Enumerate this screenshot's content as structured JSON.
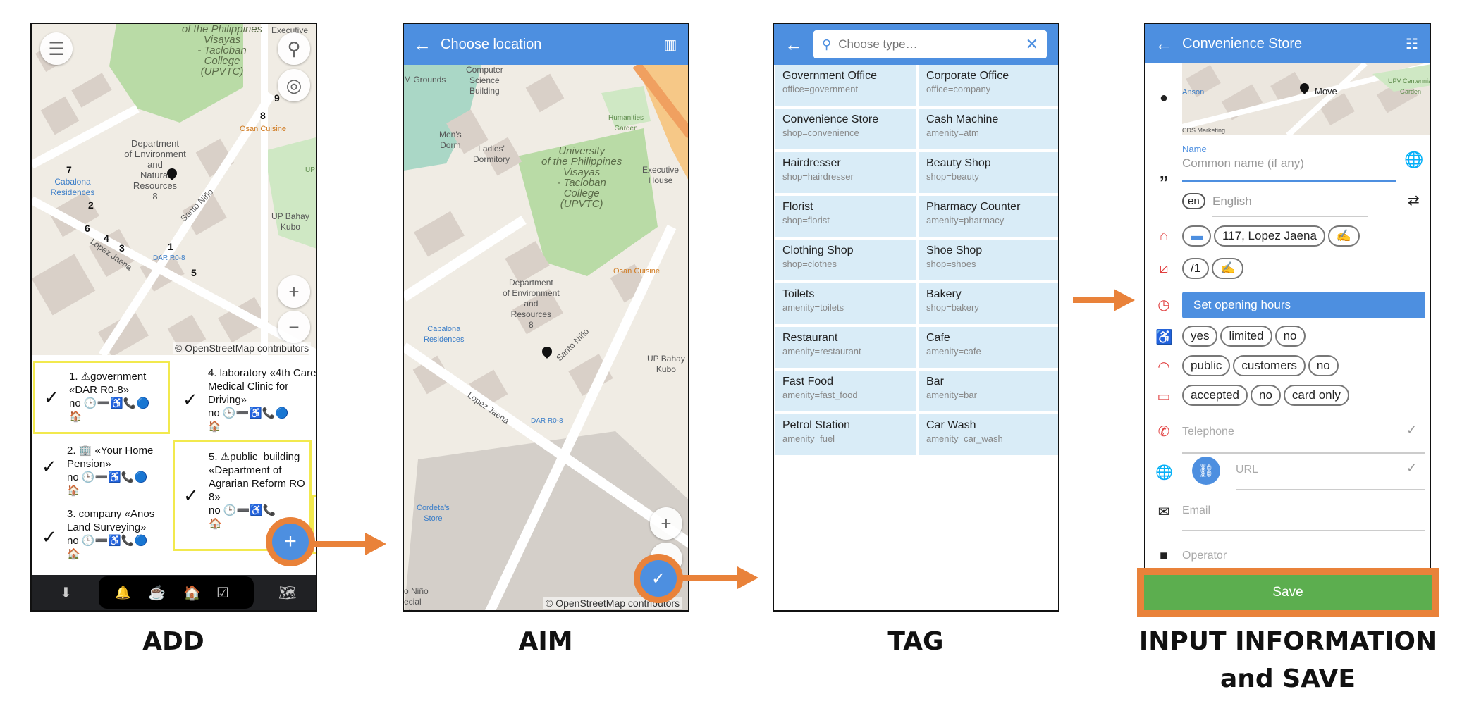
{
  "steps": {
    "add": "ADD",
    "aim": "AIM",
    "tag": "TAG",
    "input_line1": "INPUT INFORMATION",
    "input_line2": "and SAVE"
  },
  "colors": {
    "accent": "#4d8fe0",
    "highlight": "#e9823a",
    "save_green": "#5cae4f",
    "tag_bg": "#d9ecf7",
    "quest_highlight": "#f2e94e"
  },
  "screen1": {
    "map_labels": {
      "uni": "of the Philippines\nVisayas\n- Tacloban\nCollege\n(UPVTC)",
      "dept": "Department\nof Environment\nand\nNatural\nResources\n8",
      "cabalona": "Cabalona\nResidences",
      "santo_nino": "Santo Niño",
      "lopez_jaena": "Lopez Jaena",
      "dar": "DAR R0-8",
      "osan": "Osan Cuisine",
      "upbahay": "UP Bahay\nKubo",
      "executive": "Executive",
      "up": "UP"
    },
    "pins": [
      "7",
      "2",
      "6",
      "4",
      "3",
      "1",
      "5",
      "9",
      "8"
    ],
    "credit": "© OpenStreetMap contributors",
    "quests": [
      {
        "text": "1. ⚠government «DAR R0-8»",
        "icons": "no 🕒➖♿📞🔵",
        "extra": "🏠"
      },
      {
        "text": "4. laboratory «4th Care Medical Clinic for Driving»",
        "icons": "no 🕒➖♿📞🔵",
        "extra": "🏠"
      },
      {
        "text": "2. 🏢 «Your Home Pension»",
        "icons": "no 🕒➖♿📞🔵",
        "extra": "🏠"
      },
      {
        "text": "5. ⚠public_building «Department of Agrarian Reform RO 8»",
        "icons": "no 🕒➖♿📞",
        "extra": "🏠"
      },
      {
        "text": "3. company «Anos Land Surveying»",
        "icons": "no 🕒➖♿📞🔵",
        "extra": "🏠"
      }
    ],
    "nav": [
      "⬇",
      "🔔",
      "☕",
      "🏠",
      "☑",
      "🗺"
    ]
  },
  "screen2": {
    "title": "Choose location",
    "map_labels": {
      "grounds": "M Grounds",
      "computer": "Computer\nScience\nBuilding",
      "mens": "Men's\nDorm",
      "ladies": "Ladies'\nDormitory",
      "uni": "University\nof the Philippines\nVisayas\n- Tacloban\nCollege\n(UPVTC)",
      "humanities": "Humanities\nGarden",
      "executive": "Executive\nHouse",
      "osan": "Osan Cuisine",
      "dept": "Department\nof Environment\nand\nResources\n8",
      "cabalona": "Cabalona\nResidences",
      "santo_nino": "Santo Niño",
      "upbahay": "UP Bahay\nKubo",
      "lopez": "Lopez Jaena",
      "dar": "DAR R0-8",
      "cordeta": "Cordeta's\nStore",
      "snino": "o Niño\necial\nation"
    },
    "credit": "© OpenStreetMap contributors"
  },
  "screen3": {
    "search_placeholder": "Choose type…",
    "types": [
      {
        "name": "Government Office",
        "tag": "office=government"
      },
      {
        "name": "Corporate Office",
        "tag": "office=company"
      },
      {
        "name": "Convenience Store",
        "tag": "shop=convenience"
      },
      {
        "name": "Cash Machine",
        "tag": "amenity=atm"
      },
      {
        "name": "Hairdresser",
        "tag": "shop=hairdresser"
      },
      {
        "name": "Beauty Shop",
        "tag": "shop=beauty"
      },
      {
        "name": "Florist",
        "tag": "shop=florist"
      },
      {
        "name": "Pharmacy Counter",
        "tag": "amenity=pharmacy"
      },
      {
        "name": "Clothing Shop",
        "tag": "shop=clothes"
      },
      {
        "name": "Shoe Shop",
        "tag": "shop=shoes"
      },
      {
        "name": "Toilets",
        "tag": "amenity=toilets"
      },
      {
        "name": "Bakery",
        "tag": "shop=bakery"
      },
      {
        "name": "Restaurant",
        "tag": "amenity=restaurant"
      },
      {
        "name": "Cafe",
        "tag": "amenity=cafe"
      },
      {
        "name": "Fast Food",
        "tag": "amenity=fast_food"
      },
      {
        "name": "Bar",
        "tag": "amenity=bar"
      },
      {
        "name": "Petrol Station",
        "tag": "amenity=fuel"
      },
      {
        "name": "Car Wash",
        "tag": "amenity=car_wash"
      }
    ]
  },
  "screen4": {
    "title": "Convenience Store",
    "map_labels": {
      "anson": "Anson",
      "move": "Move",
      "centennial": "UPV Centennial\nGarden",
      "cds": "CDS Marketing"
    },
    "name_label": "Name",
    "name_placeholder": "Common name (if any)",
    "lang_code": "en",
    "lang_name": "English",
    "address": "117, Lopez Jaena",
    "housenumber": "/1",
    "opening_hours": "Set opening hours",
    "wheelchair": [
      "yes",
      "limited",
      "no"
    ],
    "internet": [
      "public",
      "customers",
      "no"
    ],
    "payment": [
      "accepted",
      "no",
      "card only"
    ],
    "telephone": "Telephone",
    "url": "URL",
    "email": "Email",
    "operator": "Operator",
    "save": "Save"
  }
}
